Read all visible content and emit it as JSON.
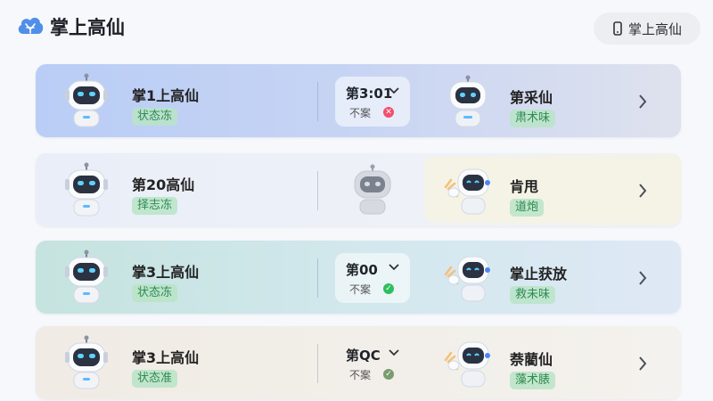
{
  "app": {
    "title": "掌上高仙",
    "top_button_label": "掌上高仙"
  },
  "colors": {
    "ok": "#2fbf5e",
    "error": "#f0506e",
    "badge_bg": "#b9e4c7",
    "badge_text": "#2f8a52"
  },
  "cards": [
    {
      "name": "掌1上高仙",
      "status": "状态冻",
      "mid_title": "第3:01",
      "mid_sub": "不案",
      "mid_status": "error",
      "right_name": "第采仙",
      "right_status": "肃术味"
    },
    {
      "name": "第20高仙",
      "status": "择志冻",
      "mid_title": "",
      "mid_sub": "",
      "mid_status": "",
      "right_name": "肯甩",
      "right_status": "道炮"
    },
    {
      "name": "掌3上高仙",
      "status": "状态冻",
      "mid_title": "第00",
      "mid_sub": "不案",
      "mid_status": "ok",
      "right_name": "掌止获放",
      "right_status": "救未味"
    },
    {
      "name": "掌3上高仙",
      "status": "状态准",
      "mid_title": "第QC",
      "mid_sub": "不案",
      "mid_status": "ok",
      "right_name": "萘藺仙",
      "right_status": "藻术脿"
    }
  ]
}
